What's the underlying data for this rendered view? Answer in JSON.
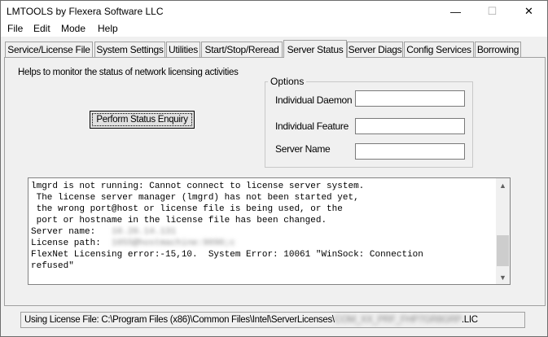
{
  "window": {
    "title": "LMTOOLS by Flexera Software LLC",
    "minimize_glyph": "—",
    "maximize_glyph": "☐",
    "close_glyph": "✕"
  },
  "menu": [
    "File",
    "Edit",
    "Mode",
    "Help"
  ],
  "tabs": [
    {
      "label": "Service/License File"
    },
    {
      "label": "System Settings"
    },
    {
      "label": "Utilities"
    },
    {
      "label": "Start/Stop/Reread"
    },
    {
      "label": "Server Status",
      "active": true
    },
    {
      "label": "Server Diags"
    },
    {
      "label": "Config Services"
    },
    {
      "label": "Borrowing"
    }
  ],
  "panel": {
    "help_text": "Helps to monitor the status of network licensing activities",
    "enquiry_button": "Perform Status Enquiry",
    "options": {
      "legend": "Options",
      "fields": [
        {
          "label": "Individual Daemon",
          "value": ""
        },
        {
          "label": "Individual Feature",
          "value": ""
        },
        {
          "label": "Server Name",
          "value": ""
        }
      ]
    },
    "output": {
      "lines": [
        "lmgrd is not running: Cannot connect to license server system.",
        " The license server manager (lmgrd) has not been started yet,",
        " the wrong port@host or license file is being used, or the",
        " port or hostname in the license file has been changed."
      ],
      "server_name_label": "Server name:",
      "server_name_value": "10.20.14.131",
      "license_path_label": "License path:",
      "license_path_value": "1055@hostmachine:9090;c",
      "error_line1": "FlexNet Licensing error:-15,10.  System Error: 10061 \"WinSock: Connection",
      "error_line2": "refused\""
    }
  },
  "status": {
    "prefix": "Using License File:  C:\\Program Files (x86)\\Common Files\\Intel\\ServerLicenses\\",
    "blurred": "COM_XX_PRF_FHP7GR8GRP",
    "suffix": ".LIC"
  }
}
